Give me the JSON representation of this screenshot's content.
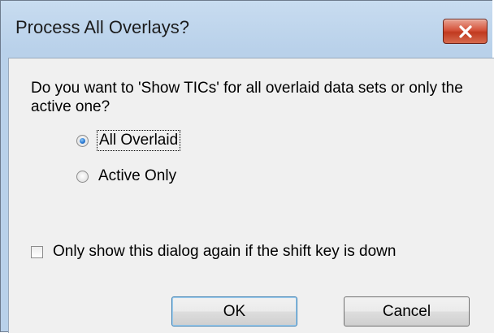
{
  "window": {
    "title": "Process All Overlays?"
  },
  "dialog": {
    "question": "Do you want to 'Show TICs' for all overlaid data sets or only the active one?",
    "options": [
      {
        "label": "All Overlaid",
        "checked": true
      },
      {
        "label": "Active Only",
        "checked": false
      }
    ],
    "checkbox_label": "Only show this dialog again if the shift key is down",
    "ok_label": "OK",
    "cancel_label": "Cancel"
  },
  "icons": {
    "close": "close-icon"
  },
  "colors": {
    "close_button": "#c7432a",
    "title_bar": "#b9d1ea",
    "client_bg": "#f0f0f0"
  }
}
